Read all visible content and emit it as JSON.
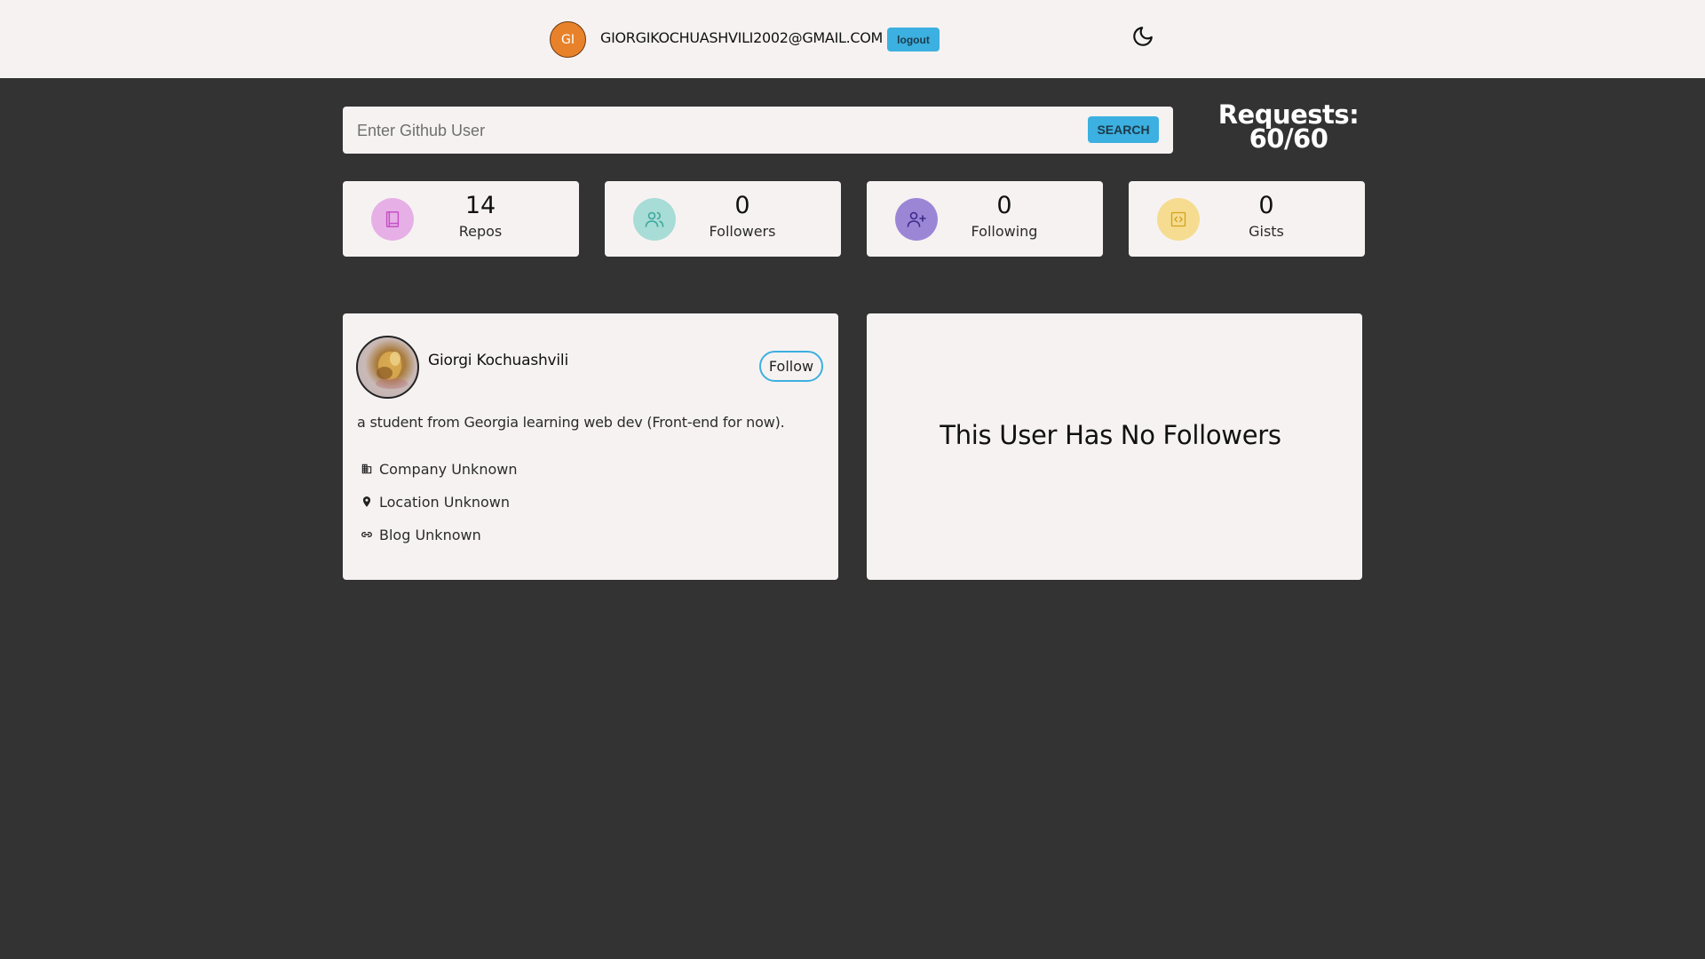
{
  "header": {
    "avatar_initials": "GI",
    "user_email": "GIORGIKOCHUASHVILI2002@GMAIL.COM",
    "logout_label": "logout",
    "theme_icon": "moon-icon"
  },
  "search": {
    "placeholder": "Enter Github User",
    "value": "",
    "button_label": "SEARCH"
  },
  "requests": {
    "label": "Requests:",
    "value": "60/60"
  },
  "stats": [
    {
      "value": "14",
      "label": "Repos",
      "icon": "book-icon",
      "color": "#e6b0e6"
    },
    {
      "value": "0",
      "label": "Followers",
      "icon": "users-icon",
      "color": "#a8dcd6"
    },
    {
      "value": "0",
      "label": "Following",
      "icon": "user-plus-icon",
      "color": "#9b86d6"
    },
    {
      "value": "0",
      "label": "Gists",
      "icon": "code-icon",
      "color": "#f5dc90"
    }
  ],
  "profile": {
    "name": "Giorgi Kochuashvili",
    "follow_label": "Follow",
    "bio": "a student from Georgia learning web dev (Front-end for now).",
    "company": "Company Unknown",
    "location": "Location Unknown",
    "blog": "Blog Unknown"
  },
  "followers": {
    "empty_message": "This User Has No Followers"
  },
  "colors": {
    "background": "#333333",
    "card": "#f7f2f2",
    "accent": "#3cb0e0",
    "avatar": "#e8822a"
  }
}
